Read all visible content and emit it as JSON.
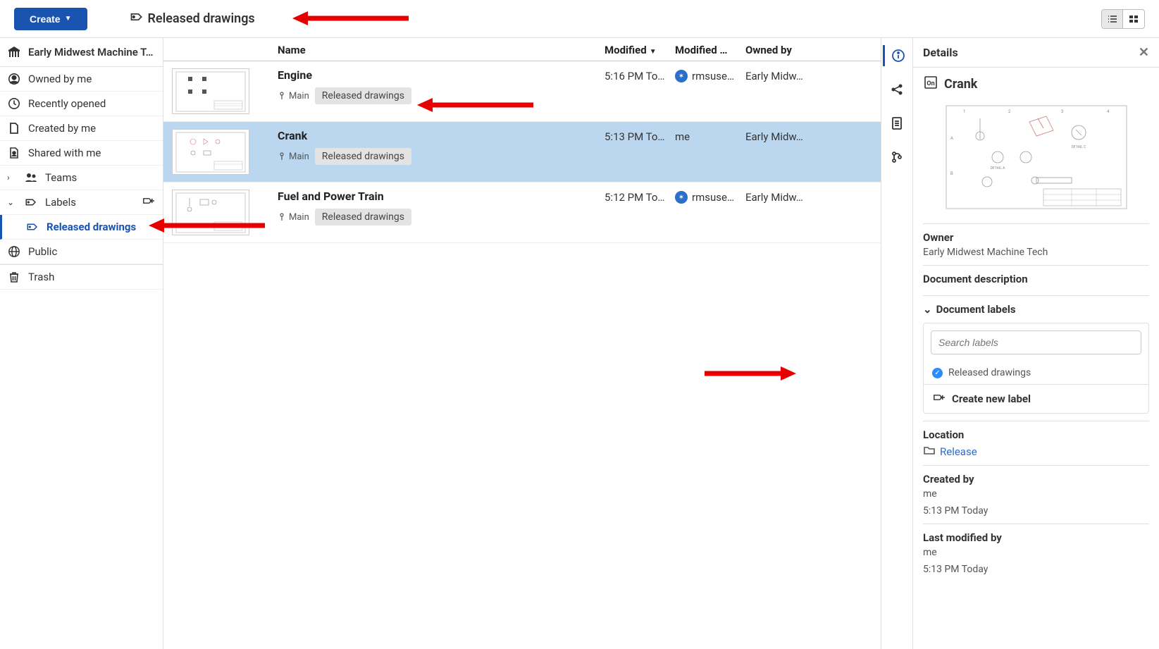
{
  "toolbar": {
    "create_label": "Create",
    "breadcrumb_title": "Released drawings"
  },
  "sidebar": {
    "team_name": "Early Midwest Machine T…",
    "items": [
      {
        "id": "owned-by-me",
        "label": "Owned by me"
      },
      {
        "id": "recently-opened",
        "label": "Recently opened"
      },
      {
        "id": "created-by-me",
        "label": "Created by me"
      },
      {
        "id": "shared-with-me",
        "label": "Shared with me"
      },
      {
        "id": "teams",
        "label": "Teams",
        "expandable": true
      },
      {
        "id": "labels",
        "label": "Labels",
        "expanded": true,
        "children": [
          {
            "id": "released-drawings",
            "label": "Released drawings",
            "active": true
          }
        ]
      },
      {
        "id": "public",
        "label": "Public"
      },
      {
        "id": "trash",
        "label": "Trash"
      }
    ]
  },
  "table": {
    "headers": {
      "name": "Name",
      "modified": "Modified",
      "modified_by": "Modified …",
      "owned_by": "Owned by"
    },
    "rows": [
      {
        "name": "Engine",
        "modified": "5:16 PM To…",
        "modified_by": "rmsuse…",
        "modified_by_icon": true,
        "owned_by": "Early Midw…",
        "branch": "Main",
        "label": "Released drawings",
        "selected": false
      },
      {
        "name": "Crank",
        "modified": "5:13 PM To…",
        "modified_by": "me",
        "modified_by_icon": false,
        "owned_by": "Early Midw…",
        "branch": "Main",
        "label": "Released drawings",
        "selected": true
      },
      {
        "name": "Fuel and Power Train",
        "modified": "5:12 PM To…",
        "modified_by": "rmsuse…",
        "modified_by_icon": true,
        "owned_by": "Early Midw…",
        "branch": "Main",
        "label": "Released drawings",
        "selected": false
      }
    ]
  },
  "details": {
    "panel_title": "Details",
    "doc_name": "Crank",
    "owner_label": "Owner",
    "owner_value": "Early Midwest Machine Tech",
    "desc_label": "Document description",
    "labels_label": "Document labels",
    "search_placeholder": "Search labels",
    "label_option": "Released drawings",
    "create_new_label": "Create new label",
    "location_label": "Location",
    "location_value": "Release",
    "created_by_label": "Created by",
    "created_by_value": "me",
    "created_at": "5:13 PM Today",
    "last_mod_label": "Last modified by",
    "last_mod_value": "me",
    "last_mod_at": "5:13 PM Today"
  }
}
